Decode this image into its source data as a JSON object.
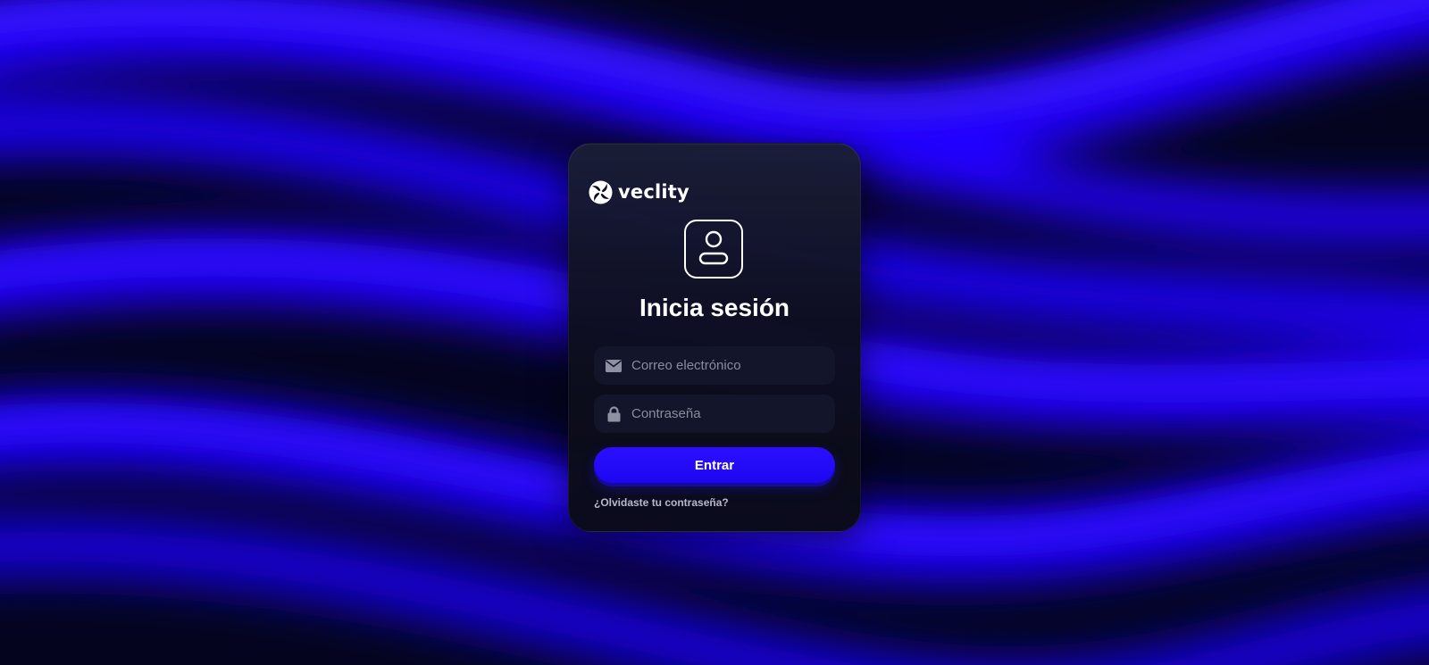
{
  "brand": {
    "name": "veclity",
    "logo_icon": "veclity-swirl-logo"
  },
  "login": {
    "avatar_icon": "user-avatar-icon",
    "title": "Inicia sesión",
    "email": {
      "icon": "envelope-icon",
      "placeholder": "Correo electrónico",
      "value": ""
    },
    "password": {
      "icon": "lock-icon",
      "placeholder": "Contraseña",
      "value": ""
    },
    "submit_label": "Entrar",
    "forgot_password_label": "¿Olvidaste tu contraseña?"
  },
  "colors": {
    "background": "#05052a",
    "accent": "#2a10ff",
    "card": "#0e0f1e",
    "field": "#13152a",
    "text": "#ffffff",
    "muted_text": "#8a8c9c"
  }
}
